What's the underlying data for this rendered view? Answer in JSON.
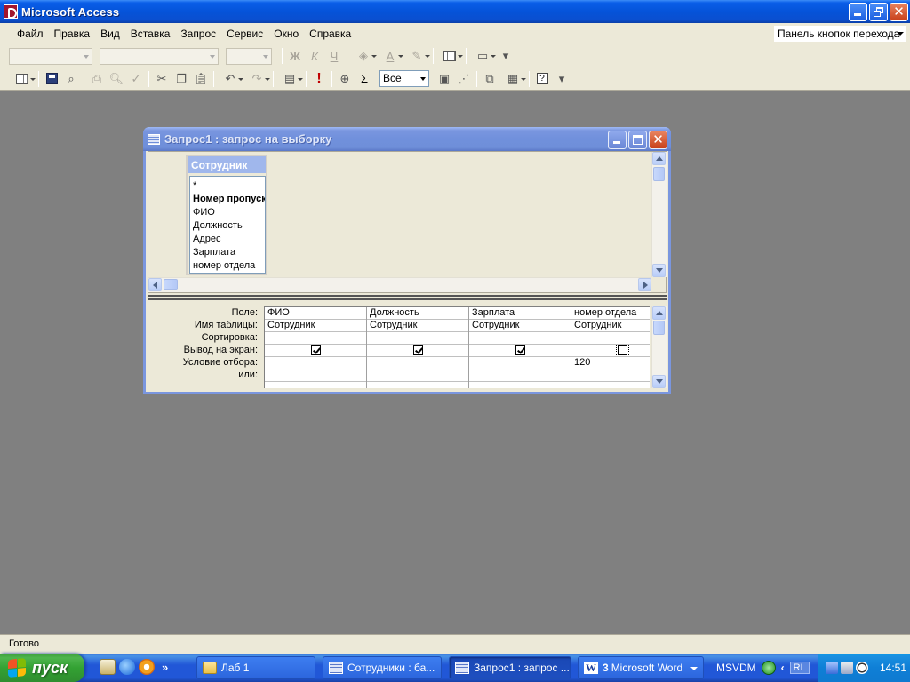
{
  "app": {
    "title": "Microsoft Access"
  },
  "menu": {
    "items": [
      "Файл",
      "Правка",
      "Вид",
      "Вставка",
      "Запрос",
      "Сервис",
      "Окно",
      "Справка"
    ],
    "nav_toolbar": "Панель кнопок перехода"
  },
  "toolbar": {
    "top_values": "Все"
  },
  "query_window": {
    "title": "Запрос1 : запрос на выборку",
    "table": {
      "name": "Сотрудник",
      "fields": [
        "*",
        "Номер пропуска",
        "ФИО",
        "Должность",
        "Адрес",
        "Зарплата",
        "номер отдела"
      ]
    },
    "grid": {
      "row_labels": [
        "Поле:",
        "Имя таблицы:",
        "Сортировка:",
        "Вывод на экран:",
        "Условие отбора:",
        "или:"
      ],
      "columns": [
        {
          "field": "ФИО",
          "table": "Сотрудник",
          "sort": "",
          "show": true,
          "criteria": "",
          "or": ""
        },
        {
          "field": "Должность",
          "table": "Сотрудник",
          "sort": "",
          "show": true,
          "criteria": "",
          "or": ""
        },
        {
          "field": "Зарплата",
          "table": "Сотрудник",
          "sort": "",
          "show": true,
          "criteria": "",
          "or": ""
        },
        {
          "field": "номер отдела",
          "table": "Сотрудник",
          "sort": "",
          "show": false,
          "criteria": "120",
          "or": ""
        }
      ]
    }
  },
  "status": {
    "text": "Готово"
  },
  "taskbar": {
    "start_label": "пуск",
    "tasks": [
      {
        "label": "Лаб 1",
        "icon": "folder-icon"
      },
      {
        "label": "Сотрудники : ба...",
        "icon": "database-icon"
      },
      {
        "label": "Запрос1 : запрос ...",
        "icon": "query-icon"
      },
      {
        "count": "3",
        "label": "Microsoft Word",
        "icon": "word-icon"
      }
    ],
    "tray_text": "MSVDM",
    "language": "RL",
    "clock": "14:51"
  },
  "colors": {
    "titlebar": "#0553d9",
    "desktop_bg": "#808080",
    "chrome": "#ece9d8"
  }
}
